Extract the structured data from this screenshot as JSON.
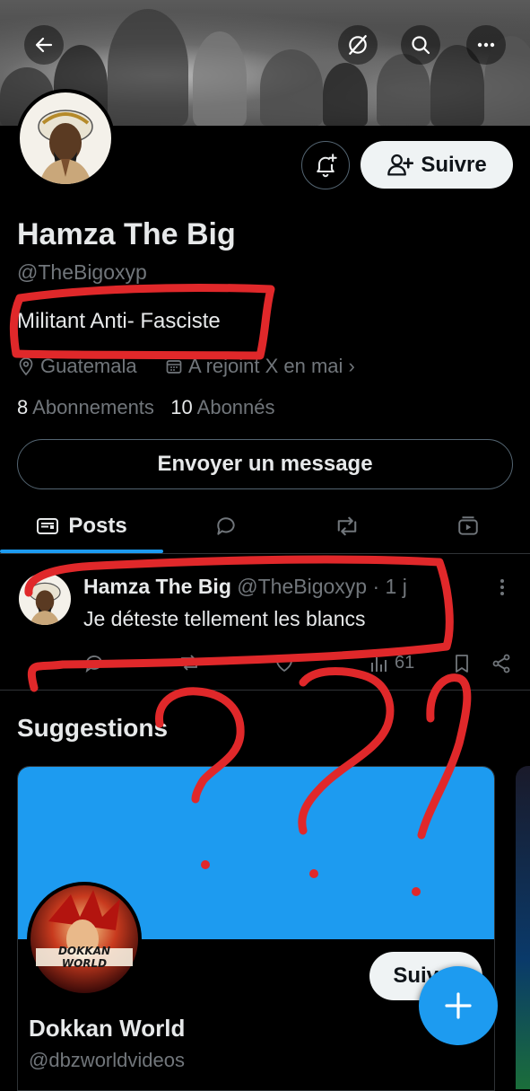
{
  "header": {
    "back_icon": "arrow-left-icon",
    "grok_icon": "grok-icon",
    "search_icon": "search-icon",
    "more_icon": "more-horizontal-icon"
  },
  "profile": {
    "name": "Hamza The Big",
    "handle": "@TheBigoxyp",
    "bio": "Militant Anti- Fasciste",
    "location": "Guatemala",
    "joined": "A rejoint X en mai",
    "following_count": "8",
    "following_label": "Abonnements",
    "followers_count": "10",
    "followers_label": "Abonnés",
    "follow_label": "Suivre",
    "message_label": "Envoyer un message"
  },
  "tabs": {
    "posts": "Posts"
  },
  "post": {
    "author": "Hamza The Big",
    "handle": "@TheBigoxyp",
    "time": "· 1 j",
    "text": "Je déteste tellement les blancs",
    "views": "61"
  },
  "suggestions": {
    "title": "Suggestions",
    "card": {
      "name": "Dokkan World",
      "handle": "@dbzworldvideos",
      "follow_label": "Suivre",
      "avatar_text": "DOKKAN WORLD"
    }
  },
  "colors": {
    "accent": "#1d9bf0",
    "annotation": "#e0282a"
  }
}
